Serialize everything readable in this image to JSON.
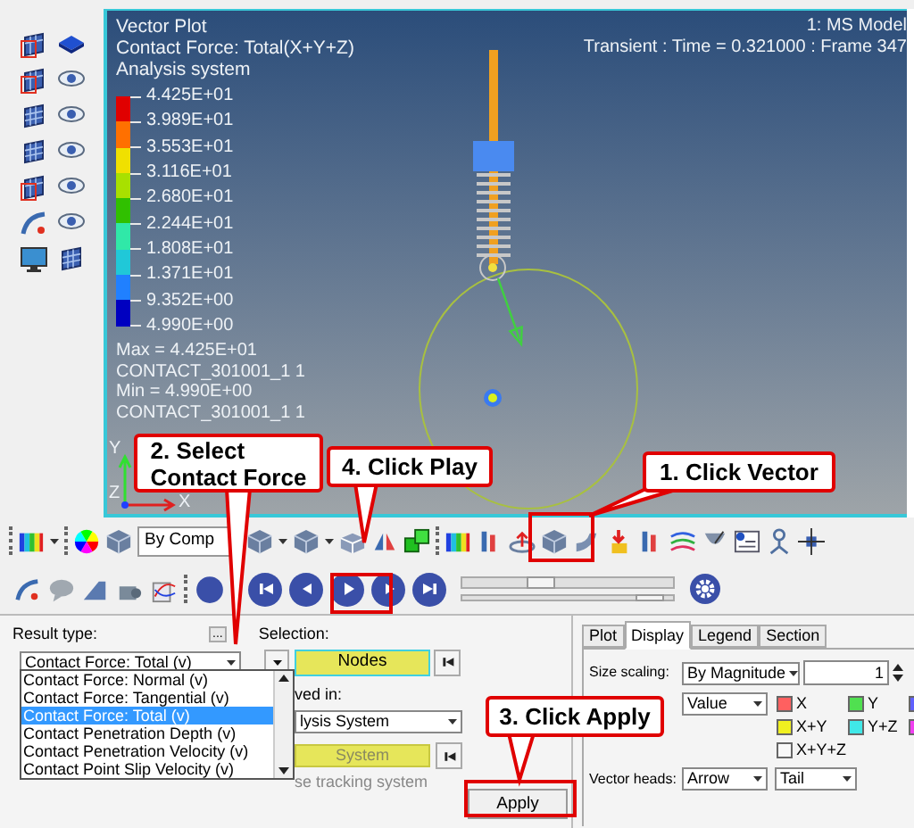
{
  "viewport": {
    "title_lines": [
      "Vector Plot",
      "Contact Force: Total(X+Y+Z)",
      "Analysis system"
    ],
    "model": "1: MS Model",
    "frame_info": "Transient : Time = 0.321000 : Frame 347",
    "legend": {
      "labels": [
        "4.425E+01",
        "3.989E+01",
        "3.553E+01",
        "3.116E+01",
        "2.680E+01",
        "2.244E+01",
        "1.808E+01",
        "1.371E+01",
        "9.352E+00",
        "4.990E+00"
      ],
      "bands": [
        {
          "color": "#e00000"
        },
        {
          "color": "#ff7000"
        },
        {
          "color": "#f0e000"
        },
        {
          "color": "#a8e000"
        },
        {
          "color": "#30c000"
        },
        {
          "color": "#30e8a8"
        },
        {
          "color": "#20c8d8"
        },
        {
          "color": "#2080ff"
        },
        {
          "color": "#0000c0"
        }
      ]
    },
    "stats": [
      "Max = 4.425E+01",
      "CONTACT_301001_1 1",
      "Min = 4.990E+00",
      "CONTACT_301001_1 1"
    ],
    "axes": {
      "y": "Y",
      "z": "Z",
      "x": "X"
    }
  },
  "callouts": [
    {
      "lines": [
        "2. Select",
        "Contact Force"
      ]
    },
    {
      "lines": [
        "4. Click Play"
      ]
    },
    {
      "lines": [
        "1. Click Vector"
      ]
    },
    {
      "lines": [
        "3. Click Apply"
      ]
    }
  ],
  "toolbar": {
    "color_mode": "By Comp",
    "frame_slider": {
      "level": 0.35
    },
    "speed_slider": {
      "level": 0.95
    }
  },
  "result_panel": {
    "result_type_label": "Result type:",
    "more_button": "...",
    "result_type_value": "Contact Force: Total (v)",
    "options": [
      {
        "label": "Contact Force: Normal (v)",
        "selected": false
      },
      {
        "label": "Contact Force: Tangential (v)",
        "selected": false
      },
      {
        "label": "Contact Force: Total (v)",
        "selected": true
      },
      {
        "label": "Contact Penetration Depth (v)",
        "selected": false
      },
      {
        "label": "Contact Penetration Velocity (v)",
        "selected": false
      },
      {
        "label": "Contact Point Slip Velocity (v)",
        "selected": false
      }
    ],
    "selection_label": "Selection:",
    "selection_value": "Nodes",
    "resolved_label": "ved in:",
    "resolved_value": "lysis System",
    "system_button": "System",
    "tracking_label": "se tracking system",
    "apply_button": "Apply"
  },
  "display_panel": {
    "tabs": [
      {
        "label": "Plot",
        "selected": false
      },
      {
        "label": "Display",
        "selected": true
      },
      {
        "label": "Legend",
        "selected": false
      },
      {
        "label": "Section",
        "selected": false
      }
    ],
    "size_scaling_label": "Size scaling:",
    "size_scaling_value": "By Magnitude",
    "scale_value": "1",
    "component_value": "Value",
    "components": [
      {
        "label": "X",
        "color": "#ff6060"
      },
      {
        "label": "Y",
        "color": "#50e050"
      },
      {
        "color": "#6060ff"
      },
      {
        "label": "X+Y",
        "color": "#f0f020"
      },
      {
        "label": "Y+Z",
        "color": "#40e8e8"
      },
      {
        "color": "#f040f0"
      },
      {
        "label": "X+Y+Z",
        "color": "#f8f8f8"
      }
    ],
    "vector_heads_label": "Vector heads:",
    "vector_heads_value": "Arrow",
    "vector_position_value": "Tail"
  }
}
